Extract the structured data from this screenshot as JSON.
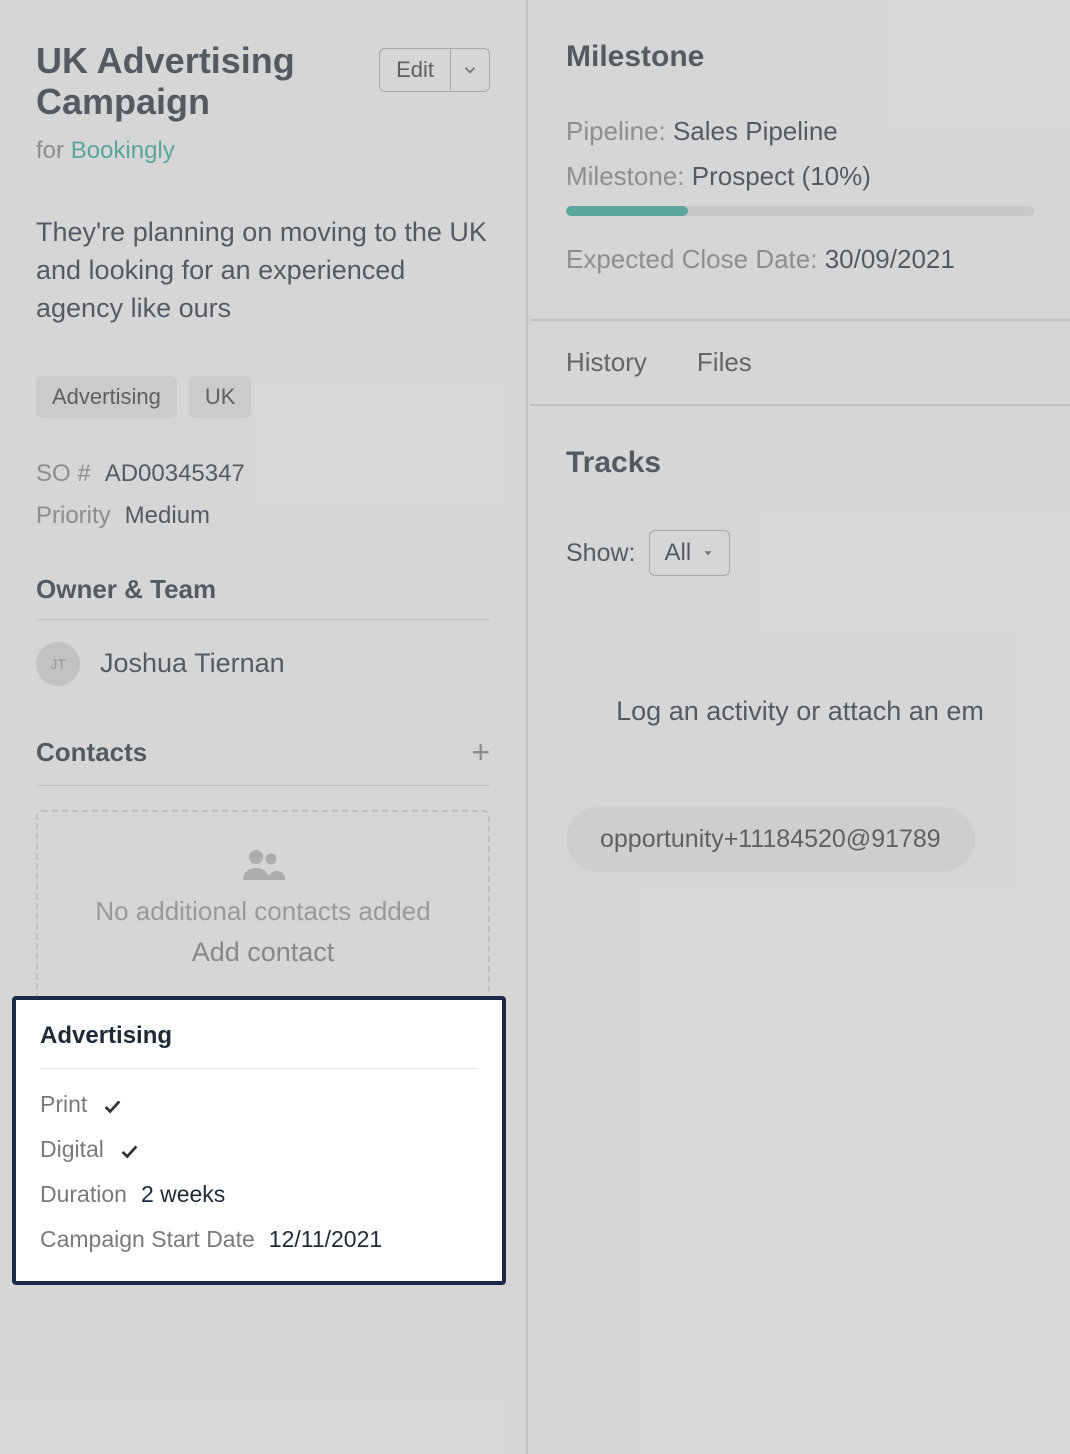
{
  "header": {
    "title": "UK Advertising Campaign",
    "edit_label": "Edit",
    "for_prefix": "for ",
    "for_entity": "Bookingly"
  },
  "description": "They're planning on moving to the UK and looking for an experienced agency like ours",
  "tags": [
    "Advertising",
    "UK"
  ],
  "meta": {
    "so_label": "SO #",
    "so_value": "AD00345347",
    "priority_label": "Priority",
    "priority_value": "Medium"
  },
  "owner": {
    "section_title": "Owner & Team",
    "initials": "JT",
    "name": "Joshua Tiernan"
  },
  "contacts": {
    "section_title": "Contacts",
    "empty_text": "No additional contacts added",
    "add_label": "Add contact"
  },
  "advertising_card": {
    "title": "Advertising",
    "print_label": "Print",
    "print_checked": true,
    "digital_label": "Digital",
    "digital_checked": true,
    "duration_label": "Duration",
    "duration_value": "2 weeks",
    "start_label": "Campaign Start Date",
    "start_value": "12/11/2021"
  },
  "milestone": {
    "title": "Milestone",
    "pipeline_label": "Pipeline:",
    "pipeline_value": "Sales Pipeline",
    "milestone_label": "Milestone:",
    "milestone_value": "Prospect (10%)",
    "progress_percent": 26,
    "close_label": "Expected Close Date:",
    "close_value": "30/09/2021"
  },
  "tabs": {
    "history": "History",
    "files": "Files"
  },
  "tracks": {
    "title": "Tracks",
    "show_label": "Show:",
    "show_value": "All",
    "log_text": "Log an activity or attach an em",
    "email": "opportunity+11184520@91789"
  }
}
